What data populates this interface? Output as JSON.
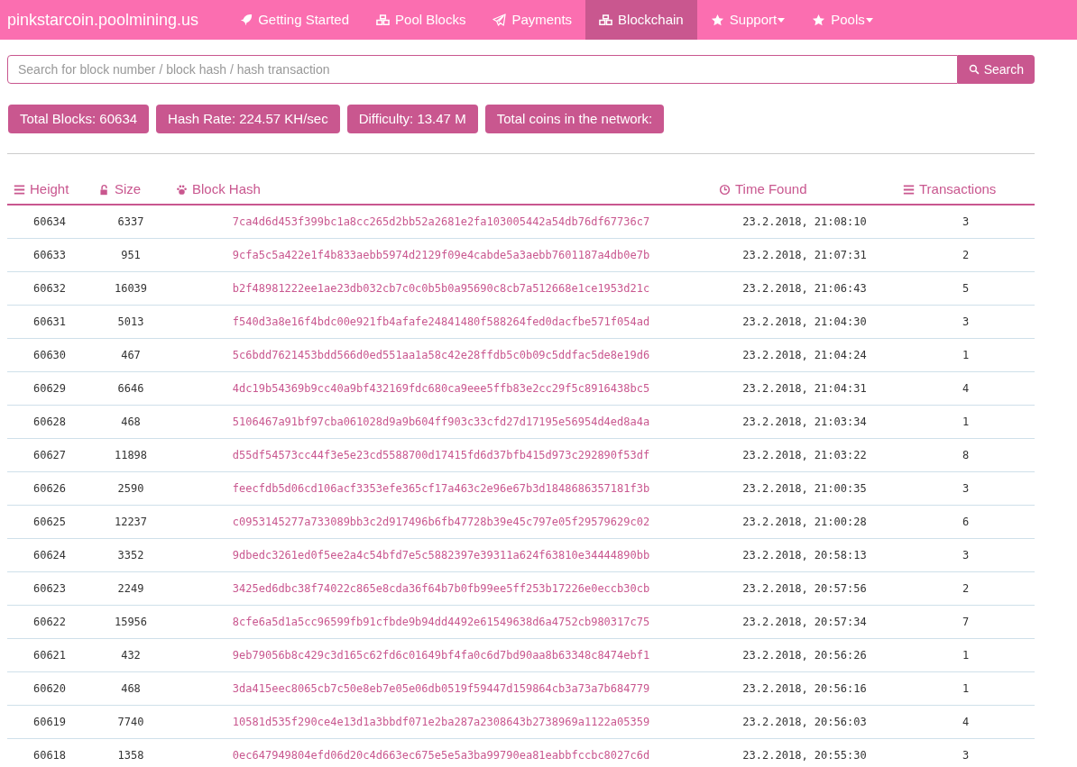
{
  "brand": "pinkstarcoin.poolmining.us",
  "nav": [
    {
      "label": "Getting Started",
      "selected": false,
      "dropdown": false
    },
    {
      "label": "Pool Blocks",
      "selected": false,
      "dropdown": false
    },
    {
      "label": "Payments",
      "selected": false,
      "dropdown": false
    },
    {
      "label": "Blockchain",
      "selected": true,
      "dropdown": false
    },
    {
      "label": "Support",
      "selected": false,
      "dropdown": true
    },
    {
      "label": "Pools",
      "selected": false,
      "dropdown": true
    }
  ],
  "search": {
    "placeholder": "Search for block number / block hash / hash transaction",
    "button": "Search"
  },
  "stats": [
    "Total Blocks: 60634",
    "Hash Rate: 224.57 KH/sec",
    "Difficulty: 13.47 M",
    "Total coins in the network:"
  ],
  "table": {
    "columns": [
      "Height",
      "Size",
      "Block Hash",
      "Time Found",
      "Transactions"
    ],
    "rows": [
      [
        "60634",
        "6337",
        "7ca4d6d453f399bc1a8cc265d2bb52a2681e2fa103005442a54db76df67736c7",
        "23.2.2018, 21:08:10",
        "3"
      ],
      [
        "60633",
        "951",
        "9cfa5c5a422e1f4b833aebb5974d2129f09e4cabde5a3aebb7601187a4db0e7b",
        "23.2.2018, 21:07:31",
        "2"
      ],
      [
        "60632",
        "16039",
        "b2f48981222ee1ae23db032cb7c0c0b5b0a95690c8cb7a512668e1ce1953d21c",
        "23.2.2018, 21:06:43",
        "5"
      ],
      [
        "60631",
        "5013",
        "f540d3a8e16f4bdc00e921fb4afafe24841480f588264fed0dacfbe571f054ad",
        "23.2.2018, 21:04:30",
        "3"
      ],
      [
        "60630",
        "467",
        "5c6bdd7621453bdd566d0ed551aa1a58c42e28ffdb5c0b09c5ddfac5de8e19d6",
        "23.2.2018, 21:04:24",
        "1"
      ],
      [
        "60629",
        "6646",
        "4dc19b54369b9cc40a9bf432169fdc680ca9eee5ffb83e2cc29f5c8916438bc5",
        "23.2.2018, 21:04:31",
        "4"
      ],
      [
        "60628",
        "468",
        "5106467a91bf97cba061028d9a9b604ff903c33cfd27d17195e56954d4ed8a4a",
        "23.2.2018, 21:03:34",
        "1"
      ],
      [
        "60627",
        "11898",
        "d55df54573cc44f3e5e23cd5588700d17415fd6d37bfb415d973c292890f53df",
        "23.2.2018, 21:03:22",
        "8"
      ],
      [
        "60626",
        "2590",
        "feecfdb5d06cd106acf3353efe365cf17a463c2e96e67b3d1848686357181f3b",
        "23.2.2018, 21:00:35",
        "3"
      ],
      [
        "60625",
        "12237",
        "c0953145277a733089bb3c2d917496b6fb47728b39e45c797e05f29579629c02",
        "23.2.2018, 21:00:28",
        "6"
      ],
      [
        "60624",
        "3352",
        "9dbedc3261ed0f5ee2a4c54bfd7e5c5882397e39311a624f63810e34444890bb",
        "23.2.2018, 20:58:13",
        "3"
      ],
      [
        "60623",
        "2249",
        "3425ed6dbc38f74022c865e8cda36f64b7b0fb99ee5ff253b17226e0eccb30cb",
        "23.2.2018, 20:57:56",
        "2"
      ],
      [
        "60622",
        "15956",
        "8cfe6a5d1a5cc96599fb91cfbde9b94dd4492e61549638d6a4752cb980317c75",
        "23.2.2018, 20:57:34",
        "7"
      ],
      [
        "60621",
        "432",
        "9eb79056b8c429c3d165c62fd6c01649bf4fa0c6d7bd90aa8b63348c8474ebf1",
        "23.2.2018, 20:56:26",
        "1"
      ],
      [
        "60620",
        "468",
        "3da415eec8065cb7c50e8eb7e05e06db0519f59447d159864cb3a73a7b684779",
        "23.2.2018, 20:56:16",
        "1"
      ],
      [
        "60619",
        "7740",
        "10581d535f290ce4e13d1a3bbdf071e2ba287a2308643b2738969a1122a05359",
        "23.2.2018, 20:56:03",
        "4"
      ],
      [
        "60618",
        "1358",
        "0ec647949804efd06d20c4d663ec675e5e5a3ba99790ea81eabbfccbc8027c6d",
        "23.2.2018, 20:55:30",
        "3"
      ]
    ]
  }
}
